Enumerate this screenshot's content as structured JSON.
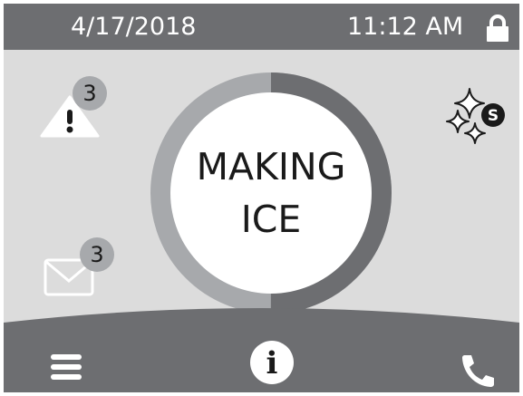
{
  "status_bar": {
    "date": "4/17/2018",
    "time": "11:12 AM",
    "icon": "lock-icon"
  },
  "notifications": {
    "alerts": {
      "icon": "alert-triangle-icon",
      "count": "3"
    },
    "messages": {
      "icon": "mail-icon",
      "count": "3"
    },
    "special_mode": {
      "icon": "sparkle-icon",
      "badge": "S"
    }
  },
  "status": {
    "line1": "MAKING",
    "line2": "ICE",
    "progress_percent": 50
  },
  "nav": {
    "menu_icon": "hamburger-menu-icon",
    "info_icon": "info-icon",
    "info_glyph": "i",
    "phone_icon": "phone-icon"
  },
  "colors": {
    "screen_background": "#dcdcdc",
    "bars": "#6d6e71",
    "ring_progress": "#6d6e71",
    "ring_remaining": "#a7a9ac",
    "badge": "#a7a9ac",
    "text": "#1a1a1a",
    "icon_light": "#ffffff"
  }
}
